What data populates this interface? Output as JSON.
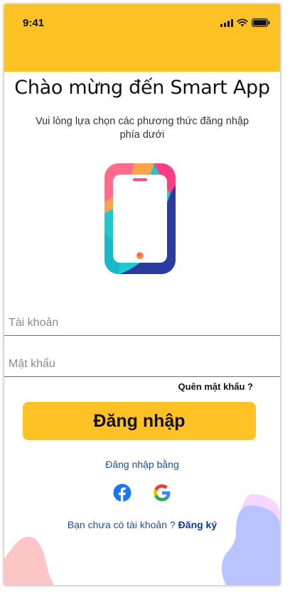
{
  "status_bar": {
    "time": "9:41"
  },
  "colors": {
    "accent": "#FFC224",
    "link": "#1d4ea0",
    "pink_deco": "#fcc6c6",
    "blue_deco": "#b9c3ff",
    "lilac_deco": "#f6d5ff"
  },
  "welcome": {
    "title": "Chào mừng đến Smart App",
    "subtitle": "Vui lòng lựa chọn các phương thức đăng nhập phía dưới"
  },
  "form": {
    "account_placeholder": "Tài khoản",
    "password_placeholder": "Mật khẩu",
    "forgot_password": "Quên mật khẩu ?",
    "login_button": "Đăng nhập"
  },
  "social": {
    "label": "Đăng nhập bằng",
    "providers": [
      "facebook-icon",
      "google-icon"
    ]
  },
  "signup": {
    "prompt": "Bạn chưa có tài khoản ?",
    "link": "Đăng ký"
  }
}
